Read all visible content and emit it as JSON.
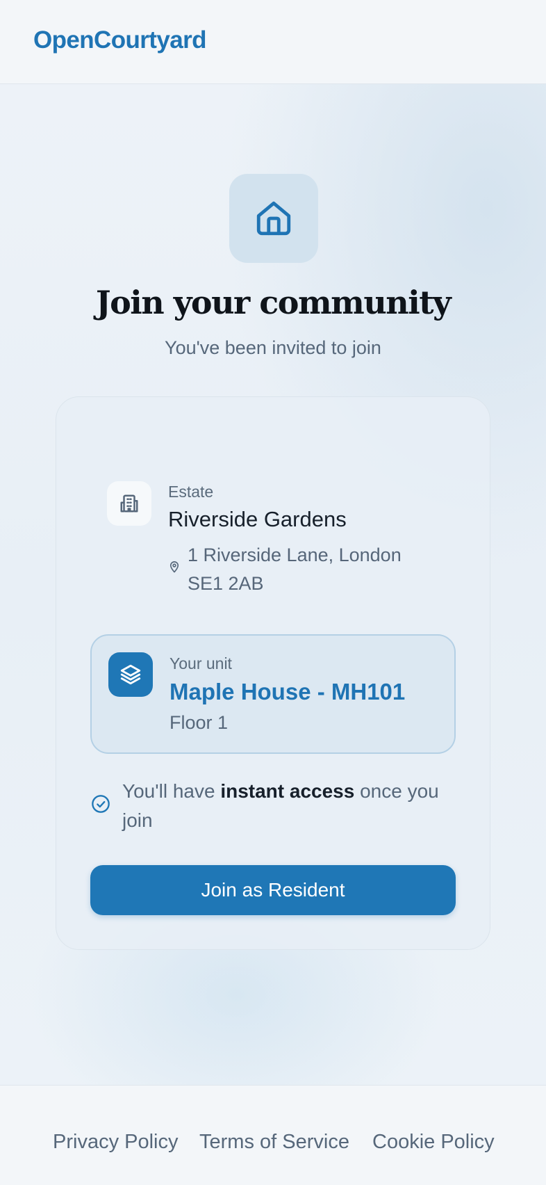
{
  "brand": "OpenCourtyard",
  "hero": {
    "icon": "home-icon",
    "title": "Join your community",
    "subtitle": "You've been invited to join"
  },
  "estate": {
    "icon": "building-icon",
    "label": "Estate",
    "name": "Riverside Gardens",
    "address_icon": "map-pin-icon",
    "address": "1 Riverside Lane, London SE1 2AB"
  },
  "unit": {
    "icon": "layers-icon",
    "label": "Your unit",
    "name": "Maple House - MH101",
    "floor": "Floor 1"
  },
  "access_note": {
    "icon": "check-circle-icon",
    "prefix": "You'll have ",
    "emphasis": "instant access",
    "suffix": " once you join"
  },
  "join_button": "Join as Resident",
  "footer": {
    "links": [
      "Privacy Policy",
      "Terms of Service",
      "Cookie Policy"
    ]
  },
  "colors": {
    "accent": "#1f77b6",
    "brand": "#1f74b4",
    "title": "#0f141a",
    "muted_text": "#56677a"
  }
}
